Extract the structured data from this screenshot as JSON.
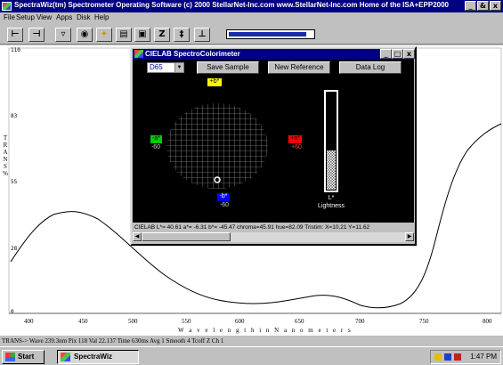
{
  "app": {
    "title": "SpectraWiz(tm) Spectrometer Operating Software (c) 2000 StellarNet-Inc.com  www.StellarNet-Inc.com  Home of the ISA+EPP2000",
    "window_controls": [
      "_",
      "&",
      "x"
    ]
  },
  "menu": [
    "File",
    "Setup",
    "View",
    "Apps",
    "Disk",
    "Help"
  ],
  "toolbar": {
    "icons": [
      "left-bracket-icon",
      "right-bracket-icon",
      "filter-icon",
      "target-icon",
      "bulb-icon",
      "printer-icon",
      "disk-icon",
      "zero-icon",
      "align-icon",
      "chart-icon"
    ],
    "glyphs": [
      "⊢",
      "⊣",
      "▿",
      "◉",
      "✦",
      "▤",
      "▣",
      "Z",
      "‡",
      "⊥"
    ],
    "progress_fraction": 0.93
  },
  "plot": {
    "y_ticks": [
      "110",
      "83",
      "55",
      "28",
      "0"
    ],
    "x_ticks": [
      "400",
      "450",
      "500",
      "550",
      "600",
      "650",
      "700",
      "750",
      "800"
    ],
    "y_title": "T R A N S %",
    "x_title": "W a v e l e n g t h   i n   N a n o m e t e r s"
  },
  "status_bar": "TRANS-> Wave 239.3nm Pix 118  Val 22.137 Time 630ms  Avg 1  Smooth 4  Tcoff Z  Ch 1",
  "cielab": {
    "title": "CIELAB SpectroColorimeter",
    "select_value": "D65",
    "save_sample": "Save Sample",
    "new_reference": "New Reference",
    "data_log": "Data Log",
    "plus_b_label": "+b*",
    "minus_b_label": "-b*",
    "plus_a_label": "+a*",
    "minus_a_label": "-a*",
    "left_value": "-60",
    "right_value": "+60",
    "bottom_value": "-60",
    "lightness_label": "L*",
    "lightness_text": "Lightness",
    "status": "CIELAB L*= 40.61  a*= -6.31  b*= -45.47  chroma=45.91  hue=82.09  Tristim: X=10.21  Y=11.62",
    "colors": {
      "plus_b": "#ffff00",
      "minus_b": "#0000ff",
      "minus_a": "#00cc00",
      "plus_a": "#ff0000"
    }
  },
  "taskbar": {
    "start": "Start",
    "task": "SpectraWiz",
    "clock": "1:47 PM"
  }
}
